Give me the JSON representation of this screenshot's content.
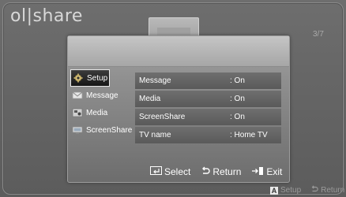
{
  "brand": "ol|share",
  "page_indicator": "3/7",
  "menu": {
    "items": [
      {
        "label": "Setup",
        "icon": "gear-icon",
        "selected": true
      },
      {
        "label": "Message",
        "icon": "envelope-icon",
        "selected": false
      },
      {
        "label": "Media",
        "icon": "media-icon",
        "selected": false
      },
      {
        "label": "ScreenShare",
        "icon": "screen-icon",
        "selected": false
      }
    ]
  },
  "settings": [
    {
      "label": "Message",
      "value": ": On"
    },
    {
      "label": "Media",
      "value": ": On"
    },
    {
      "label": "ScreenShare",
      "value": ": On"
    },
    {
      "label": "TV name",
      "value": ": Home TV"
    }
  ],
  "footer": {
    "select": "Select",
    "return": "Return",
    "exit": "Exit"
  },
  "bottom_bar": {
    "key": "A",
    "setup": "Setup",
    "return": "Return"
  },
  "colors": {
    "background": "#666666",
    "selected_bg": "#151515",
    "row_bg": "#626262",
    "text": "#ffffff"
  }
}
